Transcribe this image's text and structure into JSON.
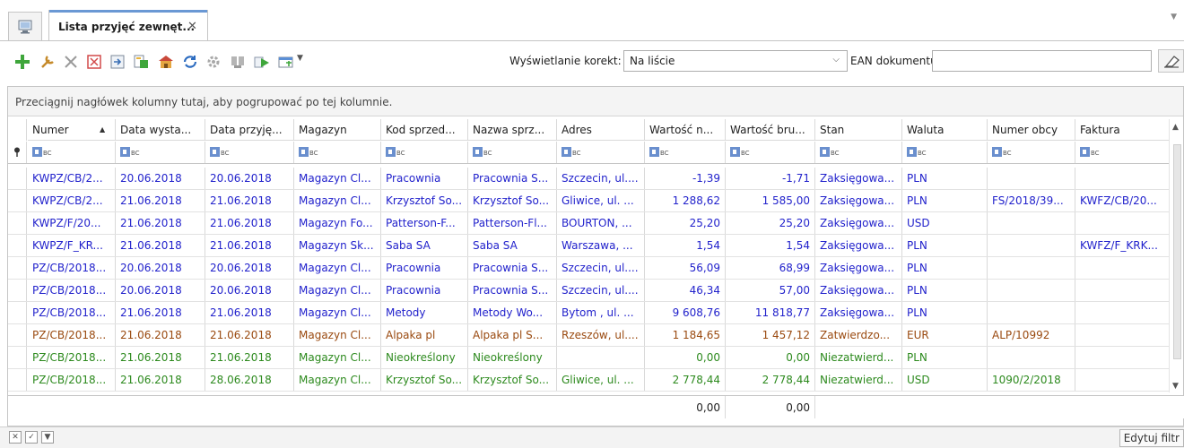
{
  "tab": {
    "label": "Lista przyjęć zewnęt...",
    "close": "✕",
    "overflow": "▼"
  },
  "toolbar": {
    "icons": [
      "add-icon",
      "edit-icon",
      "delete-icon",
      "cancel-icon",
      "export-icon",
      "document-icon",
      "warehouse-icon",
      "refresh-icon",
      "settings-icon",
      "filter-icon",
      "run-icon",
      "grid-options-icon"
    ],
    "dropdown_caret": "▼",
    "korekty_label": "Wyświetlanie korekt:",
    "korekty_value": "Na liście",
    "korekty_chevron": "⌵",
    "ean_label": "EAN dokumentu:",
    "ean_value": ""
  },
  "grid": {
    "group_hint": "Przeciągnij nagłówek kolumny tutaj, aby pogrupować po tej kolumnie.",
    "sort_indicator": "▲",
    "filter_icon_text": "BC",
    "columns": [
      "Numer",
      "Data wysta...",
      "Data przyję...",
      "Magazyn",
      "Kod sprzed...",
      "Nazwa sprz...",
      "Adres",
      "Wartość n...",
      "Wartość bru...",
      "Stan",
      "Waluta",
      "Numer obcy",
      "Faktura"
    ],
    "rows": [
      {
        "color": "#2222cc",
        "cells": [
          "KWPZ/CB/2...",
          "20.06.2018",
          "20.06.2018",
          "Magazyn Cl...",
          "Pracownia",
          "Pracownia S...",
          "Szczecin, ul....",
          "-1,39",
          "-1,71",
          "Zaksięgowa...",
          "PLN",
          "",
          ""
        ]
      },
      {
        "color": "#2222cc",
        "cells": [
          "KWPZ/CB/2...",
          "21.06.2018",
          "21.06.2018",
          "Magazyn Cl...",
          "Krzysztof So...",
          "Krzysztof So...",
          "Gliwice, ul. ...",
          "1 288,62",
          "1 585,00",
          "Zaksięgowa...",
          "PLN",
          "FS/2018/39...",
          "KWFZ/CB/20..."
        ]
      },
      {
        "color": "#2222cc",
        "cells": [
          "KWPZ/F/20...",
          "21.06.2018",
          "21.06.2018",
          "Magazyn Fo...",
          "Patterson-F...",
          "Patterson-Fl...",
          "BOURTON, ...",
          "25,20",
          "25,20",
          "Zaksięgowa...",
          "USD",
          "",
          ""
        ]
      },
      {
        "color": "#2222cc",
        "cells": [
          "KWPZ/F_KR...",
          "21.06.2018",
          "21.06.2018",
          "Magazyn Sk...",
          "Saba SA",
          "Saba SA",
          "Warszawa, ...",
          "1,54",
          "1,54",
          "Zaksięgowa...",
          "PLN",
          "",
          "KWFZ/F_KRK..."
        ]
      },
      {
        "color": "#2222cc",
        "cells": [
          "PZ/CB/2018...",
          "20.06.2018",
          "20.06.2018",
          "Magazyn Cl...",
          "Pracownia",
          "Pracownia S...",
          "Szczecin, ul....",
          "56,09",
          "68,99",
          "Zaksięgowa...",
          "PLN",
          "",
          ""
        ]
      },
      {
        "color": "#2222cc",
        "cells": [
          "PZ/CB/2018...",
          "20.06.2018",
          "20.06.2018",
          "Magazyn Cl...",
          "Pracownia",
          "Pracownia S...",
          "Szczecin, ul....",
          "46,34",
          "57,00",
          "Zaksięgowa...",
          "PLN",
          "",
          ""
        ]
      },
      {
        "color": "#2222cc",
        "cells": [
          "PZ/CB/2018...",
          "21.06.2018",
          "21.06.2018",
          "Magazyn Cl...",
          "Metody",
          "Metody Wo...",
          "Bytom , ul. ...",
          "9 608,76",
          "11 818,77",
          "Zaksięgowa...",
          "PLN",
          "",
          ""
        ]
      },
      {
        "color": "#9a4a10",
        "cells": [
          "PZ/CB/2018...",
          "21.06.2018",
          "21.06.2018",
          "Magazyn Cl...",
          "Alpaka pl",
          "Alpaka pl S...",
          "Rzeszów, ul....",
          "1 184,65",
          "1 457,12",
          "Zatwierdzo...",
          "EUR",
          "ALP/10992",
          ""
        ]
      },
      {
        "color": "#2d8a1e",
        "cells": [
          "PZ/CB/2018...",
          "21.06.2018",
          "21.06.2018",
          "Magazyn Cl...",
          "Nieokreślony",
          "Nieokreślony",
          "",
          "0,00",
          "0,00",
          "Niezatwierd...",
          "PLN",
          "",
          ""
        ]
      },
      {
        "color": "#2d8a1e",
        "cells": [
          "PZ/CB/2018...",
          "21.06.2018",
          "28.06.2018",
          "Magazyn Cl...",
          "Krzysztof So...",
          "Krzysztof So...",
          "Gliwice, ul. ...",
          "2 778,44",
          "2 778,44",
          "Niezatwierd...",
          "USD",
          "1090/2/2018",
          ""
        ]
      }
    ],
    "totals": {
      "netto": "0,00",
      "brutto": "0,00"
    },
    "scroll_up": "▲",
    "scroll_down": "▼"
  },
  "statusbar": {
    "close_filter": "✕",
    "check": "✓",
    "dropdown": "▼",
    "edit_filter": "Edytuj filtr"
  }
}
